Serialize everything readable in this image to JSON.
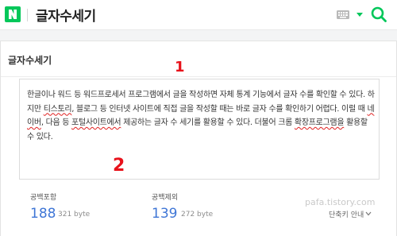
{
  "header": {
    "logo_letter": "N",
    "title": "글자수세기",
    "icons": [
      "naver-logo-icon",
      "keyboard-icon",
      "dropdown-caret-icon",
      "search-icon"
    ]
  },
  "card": {
    "title": "글자수세기"
  },
  "editor": {
    "segments": [
      {
        "text": "한글이나 워드 등 워드프로세서 프로그램에서 글을 작성하면 자체 통계 기능에서 글자 수를 확인할 수 있다. 하지만 ",
        "spell": false
      },
      {
        "text": "티스토리",
        "spell": true
      },
      {
        "text": ", 블로그 등 인터넷 사이트에 직접 글을 작성할 때는 바로 글자 수를 확인하기 어렵다. 이럴 때 ",
        "spell": false
      },
      {
        "text": "네이버",
        "spell": true
      },
      {
        "text": ", 다음 등 ",
        "spell": false
      },
      {
        "text": "포털사이트에서",
        "spell": true
      },
      {
        "text": " 제공하는 글자 수 세기를 활용할 수 있다. 더불어 크롬 ",
        "spell": false
      },
      {
        "text": "확장프로그램을",
        "spell": true
      },
      {
        "text": " 활용할 수 있다.",
        "spell": false
      }
    ]
  },
  "annotations": {
    "one": "1",
    "two": "2"
  },
  "stats": {
    "with_spaces": {
      "label": "공백포함",
      "count": "188",
      "bytes": "321 byte"
    },
    "without_spaces": {
      "label": "공백제외",
      "count": "139",
      "bytes": "272 byte"
    }
  },
  "watermark": "pafa.tistory.com",
  "shortcut": {
    "label": "단축키 안내"
  },
  "colors": {
    "brand_green": "#03c75a",
    "count_blue": "#3f76d6",
    "annotation_red": "#e8121b"
  }
}
